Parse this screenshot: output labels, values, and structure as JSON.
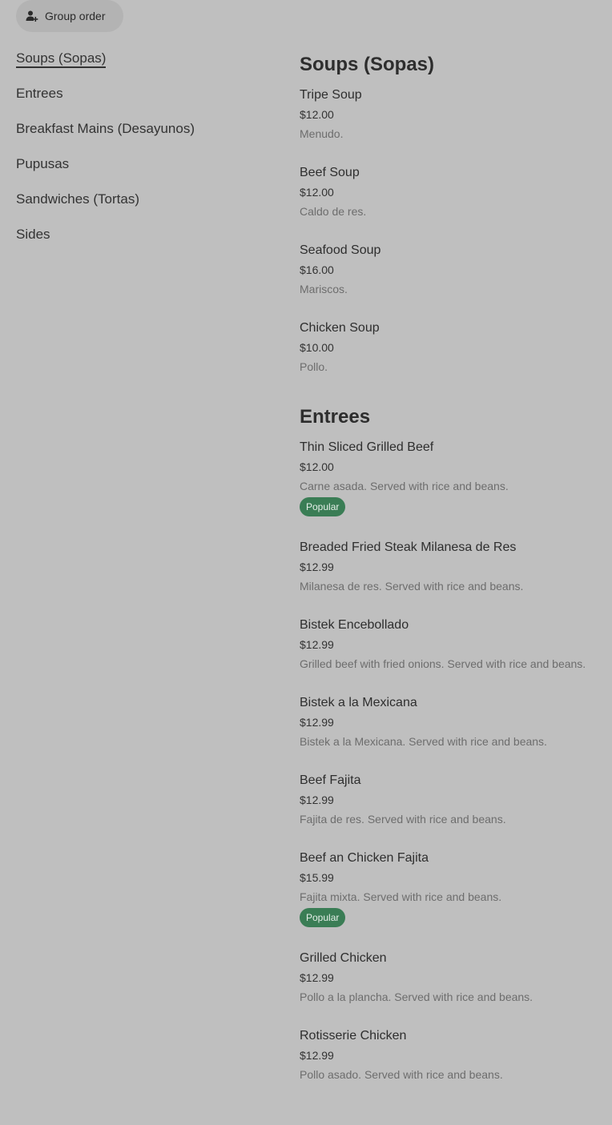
{
  "header": {
    "group_order_label": "Group order",
    "group_order_icon": "person-add-icon"
  },
  "sidebar": {
    "items": [
      {
        "label": "Soups (Sopas)",
        "active": true
      },
      {
        "label": "Entrees",
        "active": false
      },
      {
        "label": "Breakfast Mains (Desayunos)",
        "active": false
      },
      {
        "label": "Pupusas",
        "active": false
      },
      {
        "label": "Sandwiches (Tortas)",
        "active": false
      },
      {
        "label": "Sides",
        "active": false
      }
    ]
  },
  "sections": [
    {
      "title": "Soups (Sopas)",
      "items": [
        {
          "name": "Tripe Soup",
          "price": "$12.00",
          "desc": "Menudo."
        },
        {
          "name": "Beef Soup",
          "price": "$12.00",
          "desc": "Caldo de res."
        },
        {
          "name": "Seafood Soup",
          "price": "$16.00",
          "desc": "Mariscos."
        },
        {
          "name": "Chicken Soup",
          "price": "$10.00",
          "desc": "Pollo."
        }
      ]
    },
    {
      "title": "Entrees",
      "items": [
        {
          "name": "Thin Sliced Grilled Beef",
          "price": "$12.00",
          "desc": "Carne asada. Served with rice and beans.",
          "badge": "Popular"
        },
        {
          "name": "Breaded Fried Steak Milanesa de Res",
          "price": "$12.99",
          "desc": "Milanesa de res. Served with rice and beans."
        },
        {
          "name": "Bistek Encebollado",
          "price": "$12.99",
          "desc": "Grilled beef with fried onions. Served with rice and beans."
        },
        {
          "name": "Bistek a la Mexicana",
          "price": "$12.99",
          "desc": "Bistek a la Mexicana. Served with rice and beans."
        },
        {
          "name": "Beef Fajita",
          "price": "$12.99",
          "desc": "Fajita de res. Served with rice and beans."
        },
        {
          "name": "Beef an Chicken Fajita",
          "price": "$15.99",
          "desc": "Fajita mixta. Served with rice and beans.",
          "badge": "Popular"
        },
        {
          "name": "Grilled Chicken",
          "price": "$12.99",
          "desc": "Pollo a la plancha. Served with rice and beans."
        },
        {
          "name": "Rotisserie Chicken",
          "price": "$12.99",
          "desc": "Pollo asado. Served with rice and beans."
        }
      ]
    }
  ],
  "colors": {
    "background": "#bfbfbf",
    "badge": "#3a7d55"
  }
}
